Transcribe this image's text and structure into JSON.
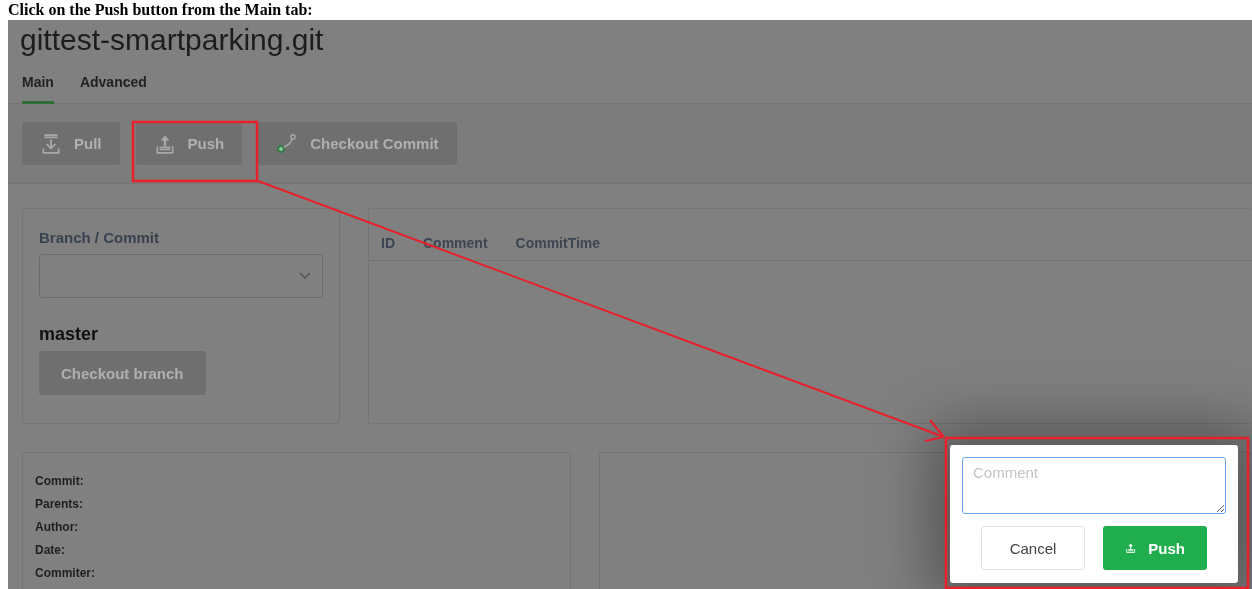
{
  "caption": "Click on the Push button from the Main tab:",
  "repo_title": "gittest-smartparking.git",
  "tabs": [
    {
      "label": "Main",
      "selected": true
    },
    {
      "label": "Advanced",
      "selected": false
    }
  ],
  "toolbar": [
    {
      "label": "Pull",
      "disabled": true
    },
    {
      "label": "Push",
      "disabled": true
    },
    {
      "label": "Checkout Commit",
      "disabled": true
    }
  ],
  "branch_panel": {
    "label": "Branch / Commit",
    "current_branch": "master",
    "button": {
      "label": "Checkout branch",
      "disabled": true
    }
  },
  "commits_table": {
    "columns": [
      "ID",
      "Comment",
      "CommitTime"
    ]
  },
  "details": {
    "fields": [
      "Commit:",
      "Parents:",
      "Author:",
      "Date:",
      "Commiter:"
    ]
  },
  "push_dialog": {
    "placeholder": "Comment",
    "buttons": [
      {
        "label": "Cancel",
        "kind": "secondary"
      },
      {
        "label": "Push",
        "kind": "primary"
      }
    ]
  }
}
